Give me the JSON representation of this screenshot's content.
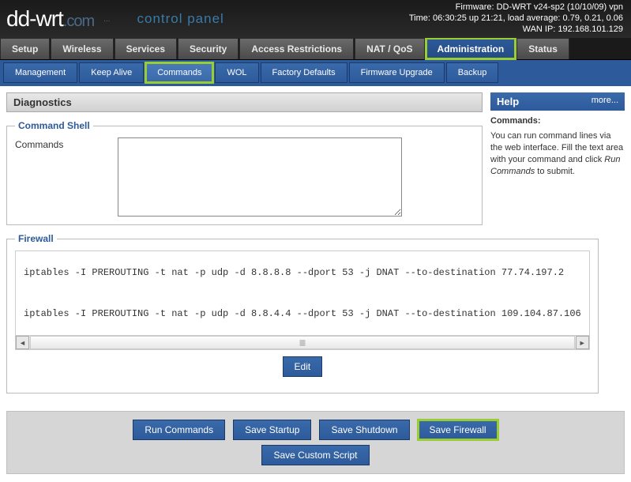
{
  "header": {
    "logo_main": "dd-wrt",
    "logo_com": ".com",
    "tagline": "control panel",
    "firmware": "Firmware: DD-WRT v24-sp2 (10/10/09) vpn",
    "time": "Time: 06:30:25 up 21:21, load average: 0.79, 0.21, 0.06",
    "wanip": "WAN IP: 192.168.101.129"
  },
  "maintabs": {
    "setup": "Setup",
    "wireless": "Wireless",
    "services": "Services",
    "security": "Security",
    "access": "Access Restrictions",
    "nat": "NAT / QoS",
    "admin": "Administration",
    "status": "Status"
  },
  "subtabs": {
    "management": "Management",
    "keepalive": "Keep Alive",
    "commands": "Commands",
    "wol": "WOL",
    "factory": "Factory Defaults",
    "firmware": "Firmware Upgrade",
    "backup": "Backup"
  },
  "diagnostics": {
    "title": "Diagnostics",
    "shell_legend": "Command Shell",
    "cmd_label": "Commands",
    "cmd_value": "",
    "firewall_legend": "Firewall",
    "firewall_code": "iptables -I PREROUTING -t nat -p udp -d 8.8.8.8 --dport 53 -j DNAT --to-destination 77.74.197.2\n\niptables -I PREROUTING -t nat -p udp -d 8.8.4.4 --dport 53 -j DNAT --to-destination 109.104.87.106",
    "edit_label": "Edit"
  },
  "help": {
    "title": "Help",
    "more": "more...",
    "heading": "Commands:",
    "body_pre": "You can run command lines via the web interface. Fill the text area with your command and click ",
    "body_em": "Run Commands",
    "body_post": " to submit."
  },
  "buttons": {
    "run": "Run Commands",
    "startup": "Save Startup",
    "shutdown": "Save Shutdown",
    "firewall": "Save Firewall",
    "custom": "Save Custom Script"
  }
}
